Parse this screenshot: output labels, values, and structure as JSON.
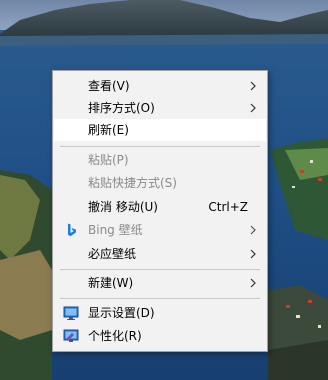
{
  "menu": {
    "view": "查看(V)",
    "sort": "排序方式(O)",
    "refresh": "刷新(E)",
    "paste": "粘贴(P)",
    "paste_shortcut": "粘贴快捷方式(S)",
    "undo_move": "撤消 移动(U)",
    "undo_shortcut": "Ctrl+Z",
    "bing_wallpaper": "Bing 壁纸",
    "biying_wallpaper": "必应壁纸",
    "new": "新建(W)",
    "display_settings": "显示设置(D)",
    "personalize": "个性化(R)"
  },
  "icons": {
    "submenu_arrow": "chevron-right-icon",
    "bing": "bing-logo-icon",
    "display": "display-settings-icon",
    "personalize": "personalize-icon"
  },
  "colors": {
    "menu_bg": "#f2f2f2",
    "hover_bg": "#ffffff",
    "disabled_text": "#8a8a8a",
    "bing_blue": "#1a7de0"
  }
}
